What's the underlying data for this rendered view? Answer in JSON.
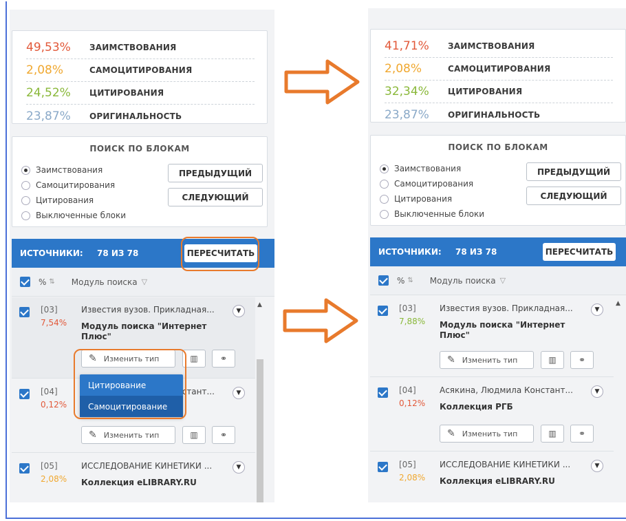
{
  "left": {
    "stats": [
      {
        "pct": "49,53%",
        "label": "ЗАИМСТВОВАНИЯ",
        "color": "#e2593a"
      },
      {
        "pct": "2,08%",
        "label": "САМОЦИТИРОВАНИЯ",
        "color": "#f0a830"
      },
      {
        "pct": "24,52%",
        "label": "ЦИТИРОВАНИЯ",
        "color": "#8ab83a"
      },
      {
        "pct": "23,87%",
        "label": "ОРИГИНАЛЬНОСТЬ",
        "color": "#8aa9c8"
      }
    ],
    "sources": {
      "label": "ИСТОЧНИКИ:",
      "count": "78 ИЗ 78",
      "recalc": "ПЕРЕСЧИТАТЬ"
    },
    "items": [
      {
        "num": "[03]",
        "pct": "7,54%",
        "pct_color": "#e2593a",
        "title": "Известия вузов. Прикладная...",
        "module": "Модуль поиска \"Интернет Плюс\""
      },
      {
        "num": "[04]",
        "pct": "0,12%",
        "pct_color": "#e2593a",
        "title": "Асякина, Людмила Констант...",
        "module": "Коллекция РГБ"
      },
      {
        "num": "[05]",
        "pct": "2,08%",
        "pct_color": "#f0a830",
        "title": "ИССЛЕДОВАНИЕ КИНЕТИКИ ...",
        "module": "Коллекция eLIBRARY.RU"
      }
    ],
    "dropdown": [
      "Цитирование",
      "Самоцитирование"
    ]
  },
  "right": {
    "stats": [
      {
        "pct": "41,71%",
        "label": "ЗАИМСТВОВАНИЯ",
        "color": "#e2593a"
      },
      {
        "pct": "2,08%",
        "label": "САМОЦИТИРОВАНИЯ",
        "color": "#f0a830"
      },
      {
        "pct": "32,34%",
        "label": "ЦИТИРОВАНИЯ",
        "color": "#8ab83a"
      },
      {
        "pct": "23,87%",
        "label": "ОРИГИНАЛЬНОСТЬ",
        "color": "#8aa9c8"
      }
    ],
    "sources": {
      "label": "ИСТОЧНИКИ:",
      "count": "78 ИЗ 78",
      "recalc": "ПЕРЕСЧИТАТЬ"
    },
    "items": [
      {
        "num": "[03]",
        "pct": "7,88%",
        "pct_color": "#8ab83a",
        "title": "Известия вузов. Прикладная...",
        "module": "Модуль поиска \"Интернет Плюс\""
      },
      {
        "num": "[04]",
        "pct": "0,12%",
        "pct_color": "#e2593a",
        "title": "Асякина, Людмила Констант...",
        "module": "Коллекция РГБ"
      },
      {
        "num": "[05]",
        "pct": "2,08%",
        "pct_color": "#f0a830",
        "title": "ИССЛЕДОВАНИЕ КИНЕТИКИ ...",
        "module": "Коллекция eLIBRARY.RU"
      }
    ]
  },
  "blocks": {
    "title": "ПОИСК ПО БЛОКАМ",
    "options": [
      "Заимствования",
      "Самоцитирования",
      "Цитирования",
      "Выключенные блоки"
    ],
    "prev": "ПРЕДЫДУЩИЙ",
    "next": "СЛЕДУЮЩИЙ"
  },
  "columns": {
    "pct": "%",
    "module": "Модуль поиска"
  },
  "item_buttons": {
    "change_type": "Изменить тип"
  },
  "icons": {
    "pencil": "pencil-icon",
    "book": "book-icon",
    "link": "link-icon",
    "filter": "filter-icon",
    "sort": "sort-icon",
    "chevron": "chevron-down-icon"
  },
  "annotation_color": "#e87a2c"
}
